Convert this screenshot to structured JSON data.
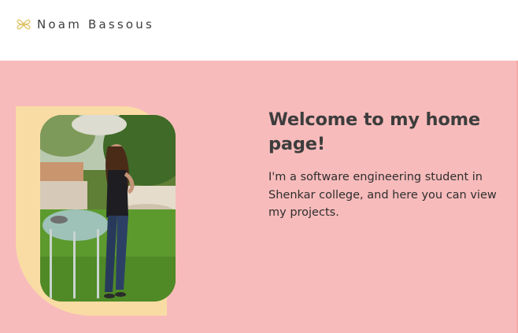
{
  "header": {
    "logo_icon": "flower-logo-icon",
    "brand_name": "Noam Bassous"
  },
  "hero": {
    "title": "Welcome to my home page!",
    "description": "I'm a software engineering student in Shenkar college, and here you can view my projects.",
    "photo": "profile-photo"
  },
  "colors": {
    "hero_background": "#f8bbbb",
    "frame_accent": "#f9dca4",
    "logo_accent": "#e0c36a",
    "text": "#3d3d3d"
  }
}
